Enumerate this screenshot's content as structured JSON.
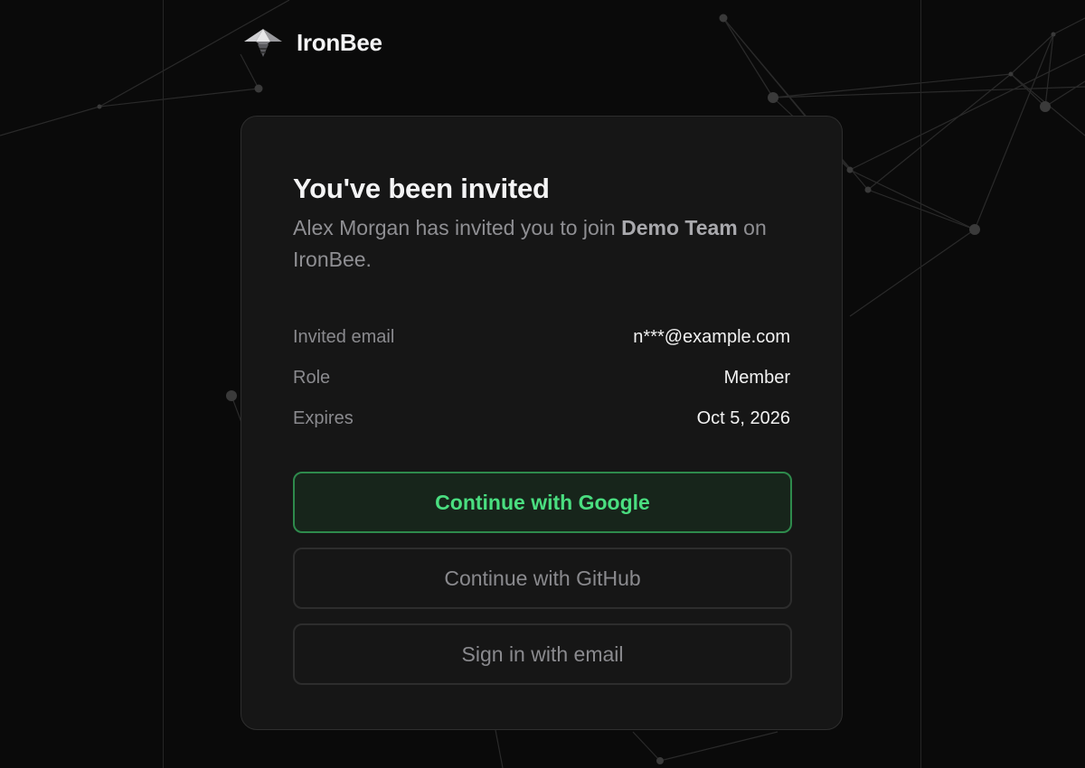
{
  "brand": {
    "name": "IronBee",
    "logo_icon": "bee-logo-icon"
  },
  "invite": {
    "title": "You've been invited",
    "subtitle_prefix": "Alex Morgan has invited you to join ",
    "team_name": "Demo Team",
    "subtitle_suffix": " on IronBee."
  },
  "details": [
    {
      "label": "Invited email",
      "value": "n***@example.com"
    },
    {
      "label": "Role",
      "value": "Member"
    },
    {
      "label": "Expires",
      "value": "Oct 5, 2026"
    }
  ],
  "actions": {
    "google_label": "Continue with Google",
    "github_label": "Continue with GitHub",
    "email_label": "Sign in with email"
  },
  "colors": {
    "background": "#0a0a0a",
    "card": "#161616",
    "accent_green": "#4ade80",
    "accent_green_border": "#2e8a4c"
  }
}
